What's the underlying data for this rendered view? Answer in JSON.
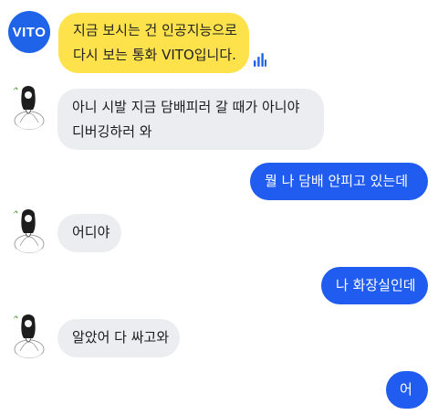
{
  "colors": {
    "vito_brand": "#1e63e8",
    "vito_bubble": "#fde24b",
    "incoming_bubble": "#ecedf0",
    "outgoing_bubble": "#1f5cef"
  },
  "vito": {
    "logo_text": "VITO",
    "message_lines": [
      "지금 보시는 건 인공지능으로",
      "다시 보는 통화 VITO입니다."
    ],
    "icon": "sound-wave-icon"
  },
  "messages": [
    {
      "from": "them",
      "lines": [
        "아니 시발 지금 담배피러 갈 때가 아니야",
        "디버깅하러 와"
      ]
    },
    {
      "from": "me",
      "lines": [
        "뭘 나 담배 안피고 있는데"
      ]
    },
    {
      "from": "them",
      "lines": [
        "어디야"
      ]
    },
    {
      "from": "me",
      "lines": [
        "나 화장실인데"
      ]
    },
    {
      "from": "them",
      "lines": [
        "알았어 다 싸고와"
      ]
    },
    {
      "from": "me",
      "lines": [
        "어"
      ]
    }
  ]
}
